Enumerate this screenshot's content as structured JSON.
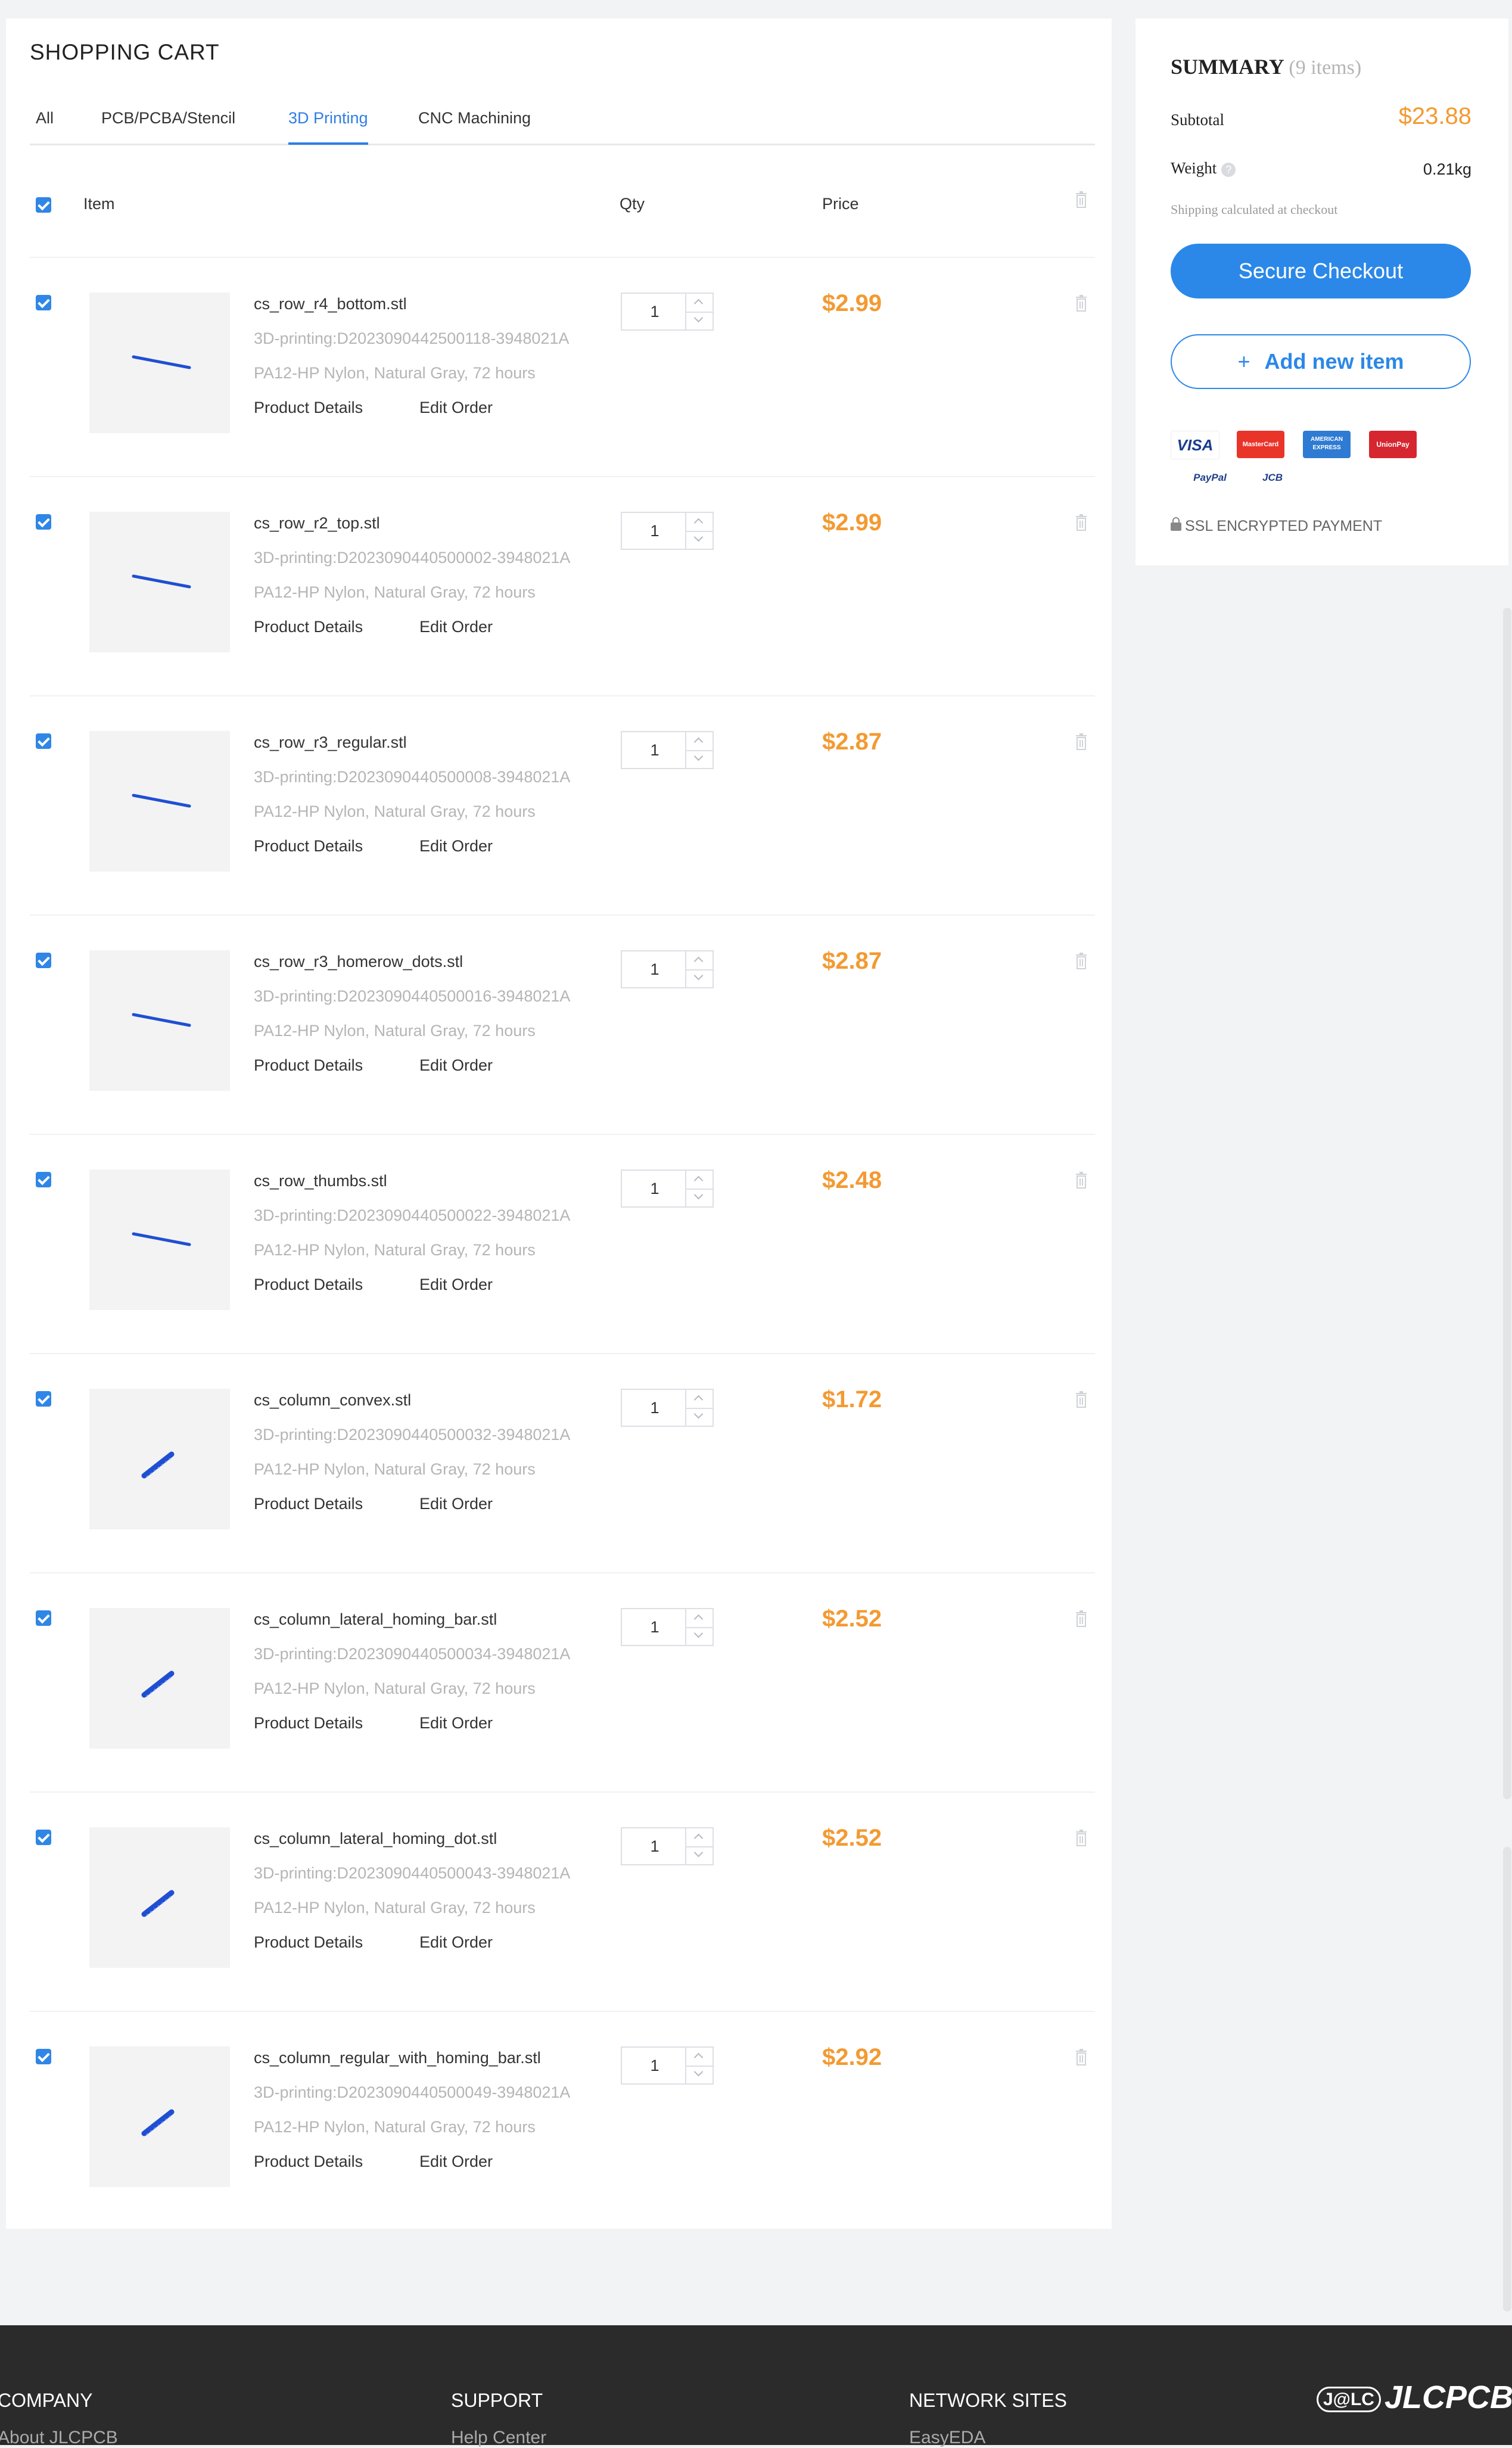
{
  "cart": {
    "title": "SHOPPING CART",
    "tabs": [
      {
        "label": "All",
        "active": false
      },
      {
        "label": "PCB/PCBA/Stencil",
        "active": false
      },
      {
        "label": "3D Printing",
        "active": true
      },
      {
        "label": "CNC Machining",
        "active": false
      }
    ],
    "columns": {
      "item": "Item",
      "qty": "Qty",
      "price": "Price"
    },
    "links": {
      "details": "Product Details",
      "edit": "Edit Order"
    },
    "items": [
      {
        "file": "cs_row_r4_bottom.stl",
        "code": "3D-printing:D2023090442500118-3948021A",
        "spec": "PA12-HP Nylon, Natural Gray, 72 hours",
        "qty": "1",
        "price": "$2.99",
        "shape": "row"
      },
      {
        "file": "cs_row_r2_top.stl",
        "code": "3D-printing:D2023090440500002-3948021A",
        "spec": "PA12-HP Nylon, Natural Gray, 72 hours",
        "qty": "1",
        "price": "$2.99",
        "shape": "row"
      },
      {
        "file": "cs_row_r3_regular.stl",
        "code": "3D-printing:D2023090440500008-3948021A",
        "spec": "PA12-HP Nylon, Natural Gray, 72 hours",
        "qty": "1",
        "price": "$2.87",
        "shape": "row"
      },
      {
        "file": "cs_row_r3_homerow_dots.stl",
        "code": "3D-printing:D2023090440500016-3948021A",
        "spec": "PA12-HP Nylon, Natural Gray, 72 hours",
        "qty": "1",
        "price": "$2.87",
        "shape": "row"
      },
      {
        "file": "cs_row_thumbs.stl",
        "code": "3D-printing:D2023090440500022-3948021A",
        "spec": "PA12-HP Nylon, Natural Gray, 72 hours",
        "qty": "1",
        "price": "$2.48",
        "shape": "row"
      },
      {
        "file": "cs_column_convex.stl",
        "code": "3D-printing:D2023090440500032-3948021A",
        "spec": "PA12-HP Nylon, Natural Gray, 72 hours",
        "qty": "1",
        "price": "$1.72",
        "shape": "column"
      },
      {
        "file": "cs_column_lateral_homing_bar.stl",
        "code": "3D-printing:D2023090440500034-3948021A",
        "spec": "PA12-HP Nylon, Natural Gray, 72 hours",
        "qty": "1",
        "price": "$2.52",
        "shape": "column"
      },
      {
        "file": "cs_column_lateral_homing_dot.stl",
        "code": "3D-printing:D2023090440500043-3948021A",
        "spec": "PA12-HP Nylon, Natural Gray, 72 hours",
        "qty": "1",
        "price": "$2.52",
        "shape": "column"
      },
      {
        "file": "cs_column_regular_with_homing_bar.stl",
        "code": "3D-printing:D2023090440500049-3948021A",
        "spec": "PA12-HP Nylon, Natural Gray, 72 hours",
        "qty": "1",
        "price": "$2.92",
        "shape": "column"
      }
    ]
  },
  "summary": {
    "title": "SUMMARY",
    "count": "(9 items)",
    "subtotal_label": "Subtotal",
    "subtotal": "$23.88",
    "weight_label": "Weight",
    "weight": "0.21kg",
    "shipping_note": "Shipping calculated at checkout",
    "checkout": "Secure Checkout",
    "add_plus": "+",
    "add": "Add new item",
    "cards": {
      "visa": "VISA",
      "mastercard": "MasterCard",
      "amex": "AMERICAN EXPRESS",
      "unionpay": "UnionPay",
      "paypal": "PayPal",
      "jcb": "JCB"
    },
    "ssl": "SSL ENCRYPTED PAYMENT"
  },
  "footer": {
    "company": "COMPANY",
    "company_link": "About JLCPCB",
    "support": "SUPPORT",
    "support_link": "Help Center",
    "network": "NETWORK SITES",
    "network_link": "EasyEDA",
    "logo": "JLCPCB",
    "logo_mark": "J@LC"
  },
  "colors": {
    "accent": "#2b88e8",
    "price": "#f39a32",
    "model": "#1f4fd1"
  },
  "icons": [
    "checkbox-icon",
    "trash-icon",
    "help-icon",
    "lock-icon",
    "chevron-up-icon",
    "chevron-down-icon"
  ]
}
